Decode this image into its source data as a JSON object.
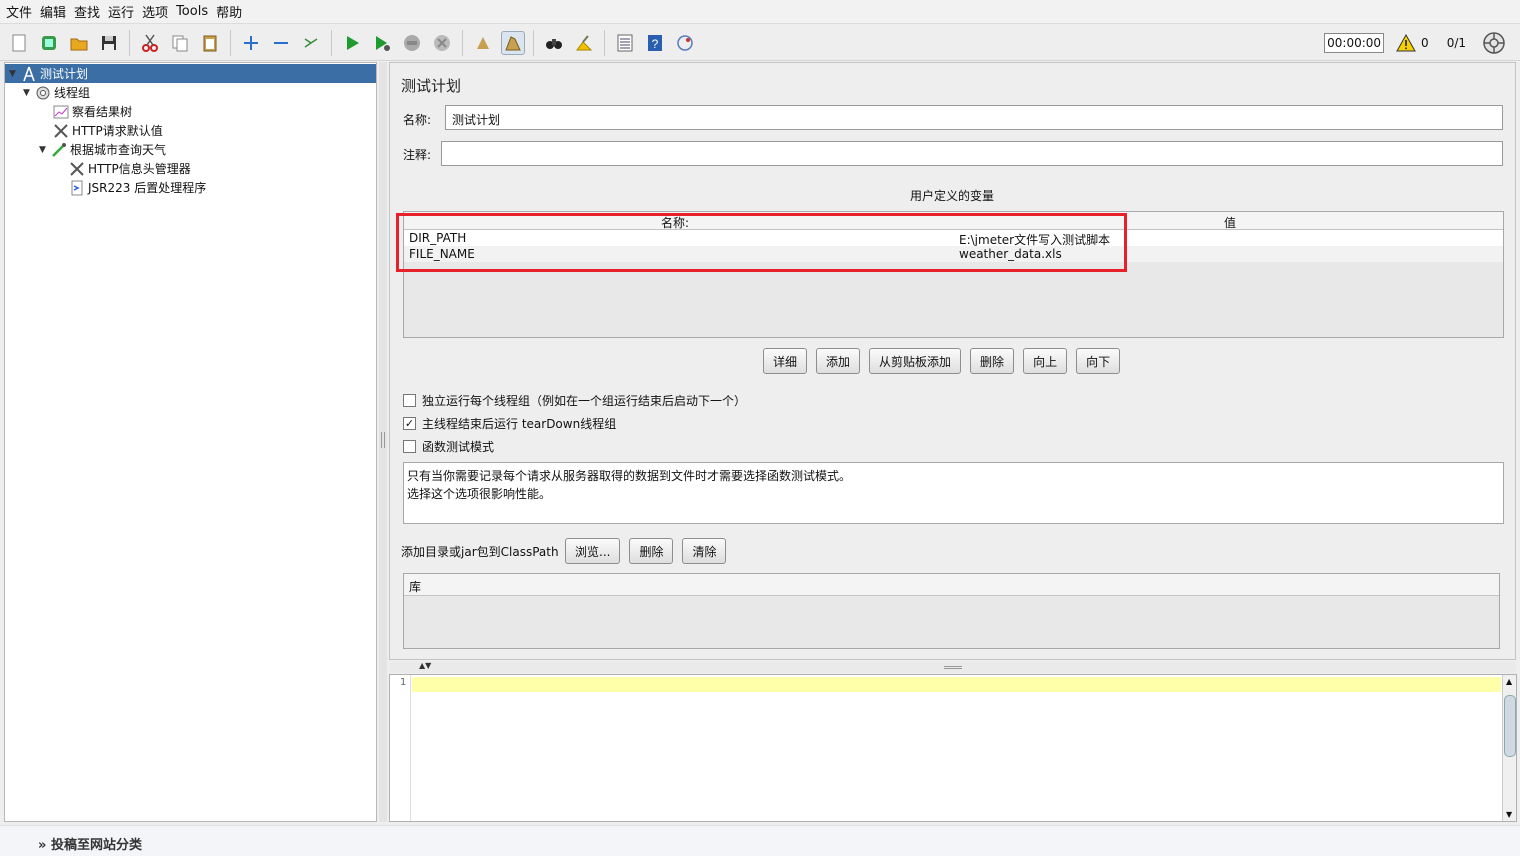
{
  "menu": [
    "文件",
    "编辑",
    "查找",
    "运行",
    "选项",
    "Tools",
    "帮助"
  ],
  "toolbar": {
    "timer": "00:00:00",
    "warnings": "0",
    "ratio": "0/1"
  },
  "tree": {
    "items": [
      {
        "label": "测试计划"
      },
      {
        "label": "线程组"
      },
      {
        "label": "察看结果树"
      },
      {
        "label": "HTTP请求默认值"
      },
      {
        "label": "根据城市查询天气"
      },
      {
        "label": "HTTP信息头管理器"
      },
      {
        "label": "JSR223 后置处理程序"
      }
    ]
  },
  "panel": {
    "title": "测试计划",
    "name_label": "名称:",
    "name_value": "测试计划",
    "comment_label": "注释:",
    "comment_value": "",
    "vars_title": "用户定义的变量",
    "col_name": "名称:",
    "col_value": "值",
    "rows": [
      {
        "name": "DIR_PATH",
        "value": "E:\\jmeter文件写入测试脚本"
      },
      {
        "name": "FILE_NAME",
        "value": "weather_data.xls"
      }
    ],
    "buttons": [
      "详细",
      "添加",
      "从剪贴板添加",
      "删除",
      "向上",
      "向下"
    ],
    "cb1": "独立运行每个线程组（例如在一个组运行结束后启动下一个）",
    "cb2": "主线程结束后运行 tearDown线程组",
    "cb3": "函数测试模式",
    "desc1": "只有当你需要记录每个请求从服务器取得的数据到文件时才需要选择函数测试模式。",
    "desc2": "选择这个选项很影响性能。",
    "classpath_label": "添加目录或jar包到ClassPath",
    "classpath_buttons": [
      "浏览...",
      "删除",
      "清除"
    ],
    "lib_header": "库"
  },
  "editor": {
    "line": "1"
  },
  "footer": {
    "text": "投稿至网站分类"
  }
}
